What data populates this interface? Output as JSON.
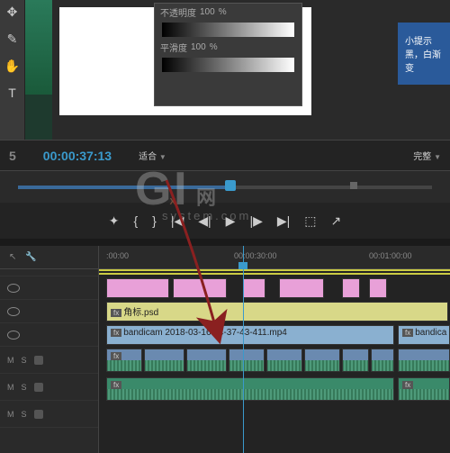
{
  "tip": {
    "title": "小提示",
    "text": "黑，白渐变"
  },
  "panel": {
    "opacity_label": "不透明度",
    "opacity_val": "100",
    "smooth_label": "平滑度",
    "smooth_val": "100"
  },
  "program": {
    "timecode": "00:00:37:13",
    "fit": "适合",
    "quality": "完整"
  },
  "source": {
    "mark": "5"
  },
  "ruler": {
    "t0": ":00:00",
    "t1": "00:00:30:00",
    "t2": "00:01:00:00"
  },
  "tracks": {
    "v2_clip": "角标.psd",
    "v1_clip": "bandicam 2018-03-16 14-37-43-411.mp4",
    "v1_clip2": "bandica",
    "fx": "fx"
  },
  "audio": {
    "m": "M",
    "s": "S"
  },
  "watermark": {
    "brand": "GXI",
    "sub": "system.com",
    "net": "网"
  }
}
